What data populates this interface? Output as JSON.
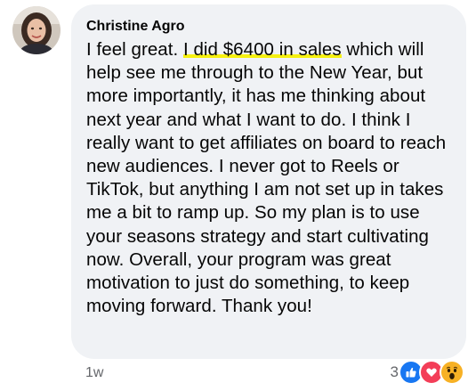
{
  "comment": {
    "author": "Christine Agro",
    "text_before_highlight": "I feel great. ",
    "highlighted_text": "I did $6400 in sales",
    "text_after_highlight": " which will help see me through to the New Year, but more importantly, it has me thinking about next year and what I want to do. I think I really want to get affiliates on board to reach new audiences. I never got to Reels or TikTok, but anything I am not set up in takes me a bit to ramp up. So my plan is to use your seasons strategy and start cultivating now. Overall, your program was great motivation to just do something, to keep moving forward. Thank you!",
    "timestamp": "1w",
    "reaction_count": "3",
    "reactions": [
      "like-icon",
      "love-icon",
      "wow-icon"
    ],
    "highlight_color": "#f6f10f",
    "bubble_color": "#f0f2f5"
  }
}
